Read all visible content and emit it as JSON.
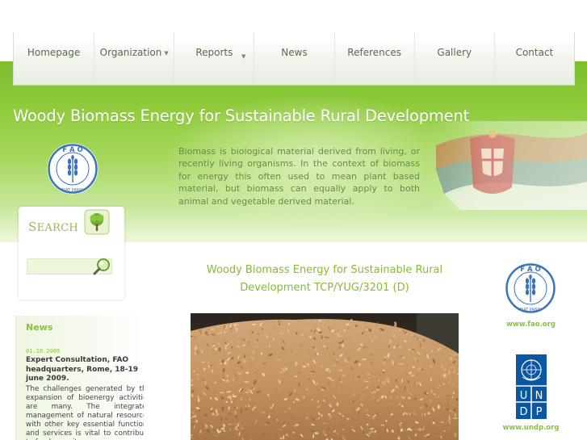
{
  "nav": {
    "items": [
      {
        "label": "Homepage",
        "has_dropdown": false
      },
      {
        "label": "Organization",
        "has_dropdown": true
      },
      {
        "label": "Reports",
        "has_dropdown": true
      },
      {
        "label": "News",
        "has_dropdown": false
      },
      {
        "label": "References",
        "has_dropdown": false
      },
      {
        "label": "Gallery",
        "has_dropdown": false
      },
      {
        "label": "Contact",
        "has_dropdown": false
      }
    ],
    "dropdown_icon": "chevron-down-icon"
  },
  "hero": {
    "title": "Woody Biomass Energy for Sustainable Rural Development",
    "text": "Biomass is biological material derived from living, or recently living organisms. In the context of biomass for energy this often used to mean plant based material, but biomass can equally apply to both animal and vegetable derived material.",
    "logo_icon": "fao-logo-icon",
    "flag_icon": "serbian-flag-icon"
  },
  "search": {
    "label_cap": "S",
    "label_rest": "EARCH",
    "placeholder": "",
    "leaf_icon": "leaf-tree-icon",
    "button_icon": "magnifier-icon"
  },
  "news": {
    "title": "News",
    "date": "01.10.2009",
    "headline": "Expert Consultation, FAO headquarters, Rome, 18-19 june 2009.",
    "body": "The challenges generated by the expansion of bioenergy activities are many. The integrated management of natural resources with other key essential functions and services is vital to contribute to food security, energy"
  },
  "main": {
    "title": "Woody Biomass Energy for Sustainable Rural Development TCP/YUG/3201 (D)",
    "image_subject": "wood-chips-pile"
  },
  "sidebar": {
    "fao_link": "www.fao.org",
    "undp_link": "www.undp.org",
    "undp_letters": [
      "U",
      "N",
      "D",
      "P"
    ]
  },
  "colors": {
    "brand_green": "#8cbf3c",
    "fao_blue": "#3b73b9",
    "undp_blue": "#0b57a3",
    "nav_text": "#5a6a4a"
  }
}
